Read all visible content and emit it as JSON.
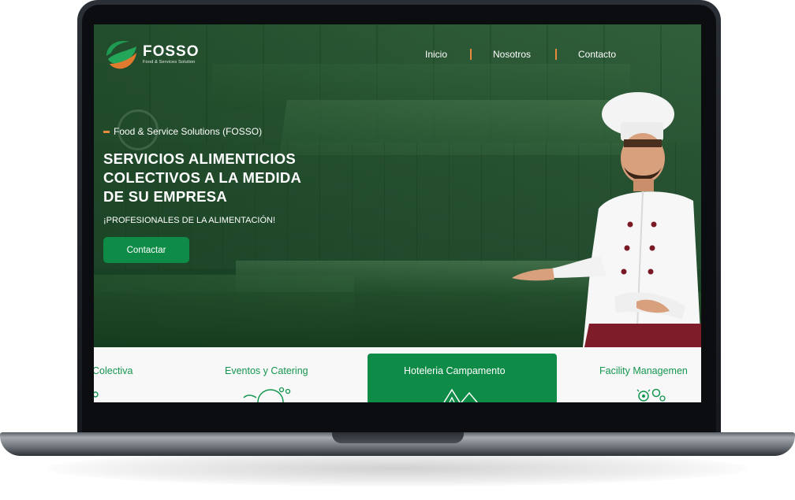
{
  "brand": {
    "name": "FOSSO",
    "tagline": "Food & Services Solution",
    "logo_icon": "fosso-logo-icon",
    "colors": {
      "primary_green": "#0e8b46",
      "accent_orange": "#e88a3c"
    }
  },
  "nav": {
    "items": [
      {
        "label": "Inicio"
      },
      {
        "label": "Nosotros"
      },
      {
        "label": "Contacto"
      }
    ]
  },
  "hero": {
    "eyebrow": "Food & Service Solutions (FOSSO)",
    "headline_lines": [
      "SERVICIOS ALIMENTICIOS",
      "COLECTIVOS A LA MEDIDA",
      "DE SU EMPRESA"
    ],
    "subheadline": "¡PROFESIONALES DE LA ALIMENTACIÓN!",
    "cta_label": "Contactar",
    "image": "chef-presenting-kitchen-photo"
  },
  "services": {
    "items": [
      {
        "label": "Colectiva",
        "icon": "food-service-icon",
        "active": false
      },
      {
        "label": "Eventos y Catering",
        "icon": "catering-platter-icon",
        "active": false
      },
      {
        "label": "Hoteleria Campamento",
        "icon": "camp-tent-icon",
        "active": true
      },
      {
        "label": "Facility Managemen",
        "icon": "facility-gears-icon",
        "active": false
      }
    ]
  }
}
